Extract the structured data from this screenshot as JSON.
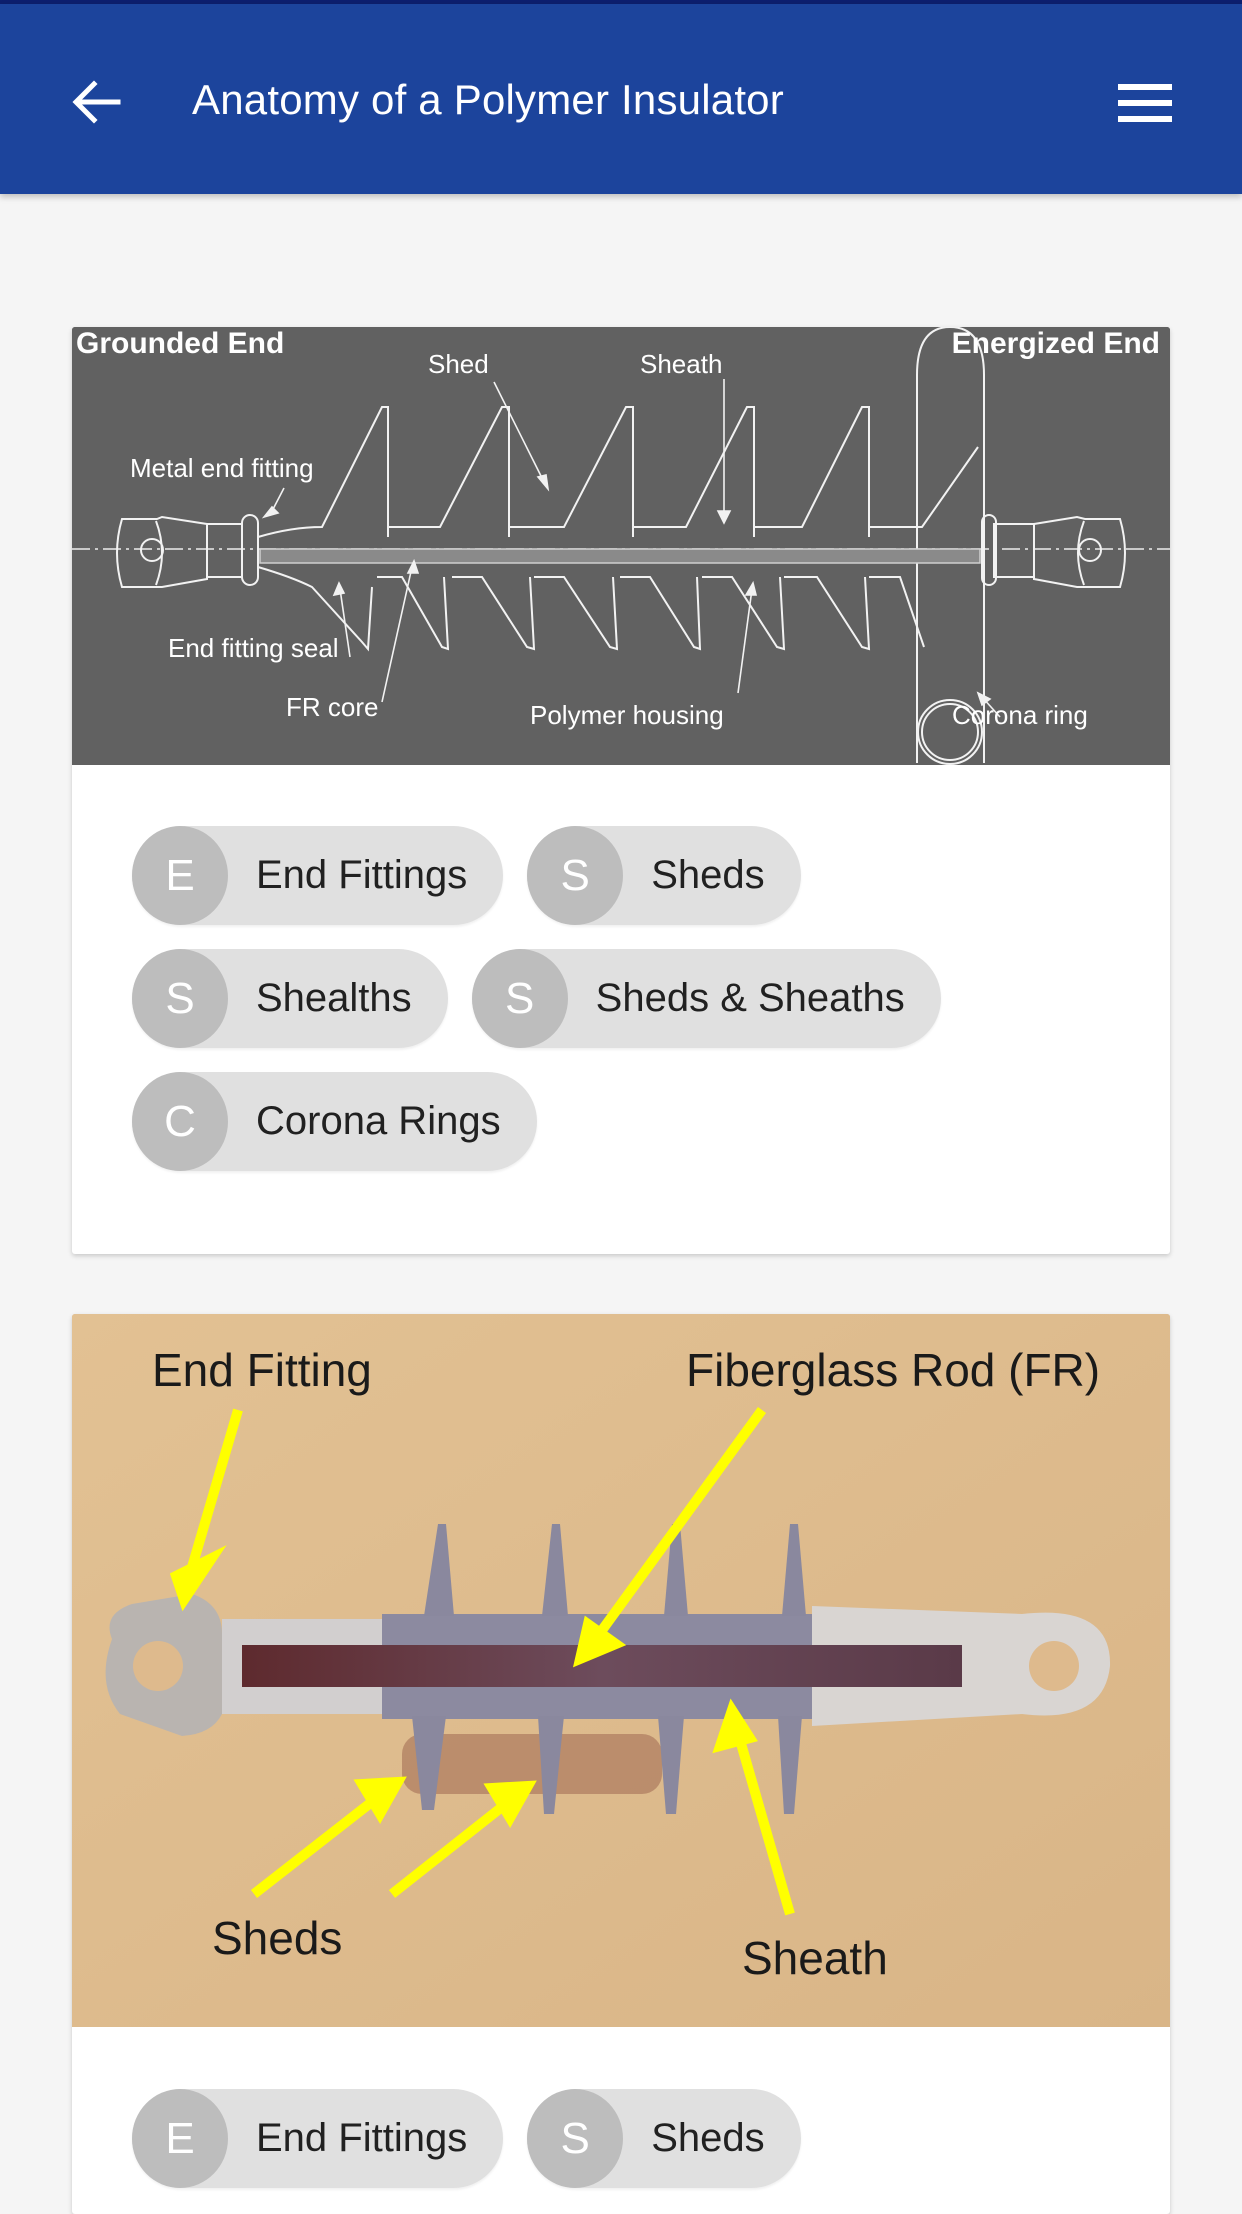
{
  "app_bar": {
    "title": "Anatomy of a Polymer Insulator",
    "back_icon": "arrow-left-icon",
    "menu_icon": "hamburger-menu-icon",
    "color": "#1c449c"
  },
  "cards": [
    {
      "image": {
        "type": "diagram",
        "labels": {
          "grounded_end": "Grounded End",
          "energized_end": "Energized End",
          "shed": "Shed",
          "sheath": "Sheath",
          "metal_end_fitting": "Metal end fitting",
          "end_fitting_seal": "End fitting seal",
          "fr_core": "FR core",
          "polymer_housing": "Polymer housing",
          "corona_ring": "Corona ring"
        }
      },
      "chips": [
        {
          "letter": "E",
          "label": "End Fittings"
        },
        {
          "letter": "S",
          "label": "Sheds"
        },
        {
          "letter": "S",
          "label": "Shealths"
        },
        {
          "letter": "S",
          "label": "Sheds & Sheaths"
        },
        {
          "letter": "C",
          "label": "Corona Rings"
        }
      ]
    },
    {
      "image": {
        "type": "photo",
        "labels": {
          "end_fitting": "End Fitting",
          "fiberglass_rod": "Fiberglass Rod (FR)",
          "sheds": "Sheds",
          "sheath": "Sheath"
        }
      },
      "chips": [
        {
          "letter": "E",
          "label": "End Fittings"
        },
        {
          "letter": "S",
          "label": "Sheds"
        }
      ]
    }
  ]
}
